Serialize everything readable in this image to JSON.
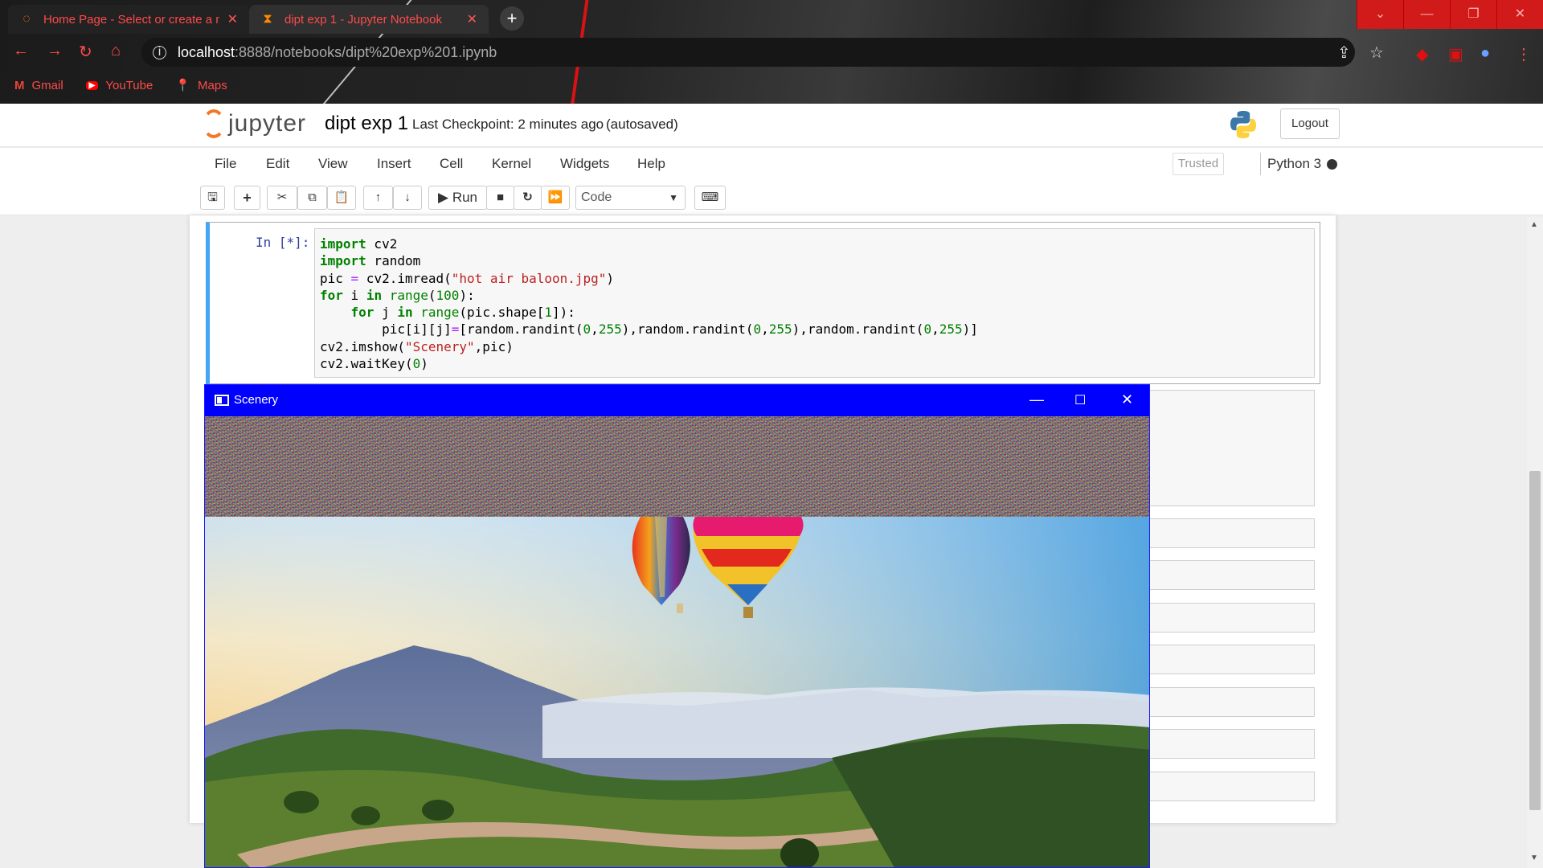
{
  "browser": {
    "tabs": [
      {
        "title": "Home Page - Select or create a n",
        "active": false
      },
      {
        "title": "dipt exp 1 - Jupyter Notebook",
        "active": true
      }
    ],
    "url_host": "localhost",
    "url_path": ":8888/notebooks/dipt%20exp%201.ipynb",
    "bookmarks": [
      {
        "label": "Gmail",
        "icon": "gmail-icon"
      },
      {
        "label": "YouTube",
        "icon": "youtube-icon"
      },
      {
        "label": "Maps",
        "icon": "maps-icon"
      }
    ]
  },
  "jupyter": {
    "logo_text": "jupyter",
    "notebook_name": "dipt exp 1",
    "checkpoint": "Last Checkpoint: 2 minutes ago",
    "autosaved": "(autosaved)",
    "logout_label": "Logout",
    "menu": [
      "File",
      "Edit",
      "View",
      "Insert",
      "Cell",
      "Kernel",
      "Widgets",
      "Help"
    ],
    "trusted_label": "Trusted",
    "kernel_name": "Python 3",
    "toolbar": {
      "run_label": "Run",
      "cell_type": "Code"
    }
  },
  "cell": {
    "prompt": "In [*]:",
    "code_lines": [
      "import cv2",
      "import random",
      "pic = cv2.imread(\"hot air baloon.jpg\")",
      "for i in range(100):",
      "    for j in range(pic.shape[1]):",
      "        pic[i][j]=[random.randint(0,255),random.randint(0,255),random.randint(0,255)]",
      "cv2.imshow(\"Scenery\",pic)",
      "cv2.waitKey(0)"
    ]
  },
  "image_window": {
    "title": "Scenery",
    "accent": "#0000ff"
  },
  "colors": {
    "tab_text": "#ff4a4a",
    "jupyter_orange": "#f37726",
    "cell_border_running": "#42a5f5"
  }
}
